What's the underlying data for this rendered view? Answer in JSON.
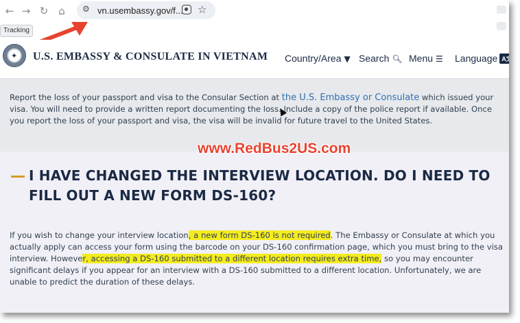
{
  "browser": {
    "url": "vn.usembassy.gov/f...",
    "tracking_label": "Tracking"
  },
  "site": {
    "title": "U.S. EMBASSY & CONSULATE IN VIETNAM",
    "nav": {
      "country": "Country/Area",
      "search": "Search",
      "menu": "Menu",
      "language": "Language",
      "language_badge": "A文"
    }
  },
  "content": {
    "lost_passport": {
      "before_link": "Report the loss of your passport and visa to the Consular Section at ",
      "link": "the U.S. Embassy or Consulate",
      "after_link": " which issued your visa. You will need to provide a written report documenting the loss. Include a copy of the police report if available. Once you report the loss of your passport and visa, the visa will be invalid for future travel to the United States."
    },
    "watermark": "www.RedBus2US.com",
    "heading": "I HAVE CHANGED THE INTERVIEW LOCATION. DO I NEED TO FILL OUT A NEW FORM DS-160?",
    "answer": {
      "p1": "If you wish to change your interview location",
      "h1": ", a new form DS-160 is not required",
      "p2": ". The Embassy or Consulate at which you actually apply can access your form using the barcode on your DS-160 confirmation page, which you must bring to the visa interview. Howeve",
      "h2": "r, accessing a DS-160 submitted to a different location requires extra time,",
      "p3": " so you may encounter significant delays if you appear for an interview with a DS-160 submitted to a different location. Unfortunately, we are unable to predict the duration of these delays."
    }
  },
  "colors": {
    "accent_arrow": "#e8432f",
    "highlight": "#f4ec1e",
    "heading_dash": "#d49a2a",
    "navy": "#1b2a44"
  }
}
